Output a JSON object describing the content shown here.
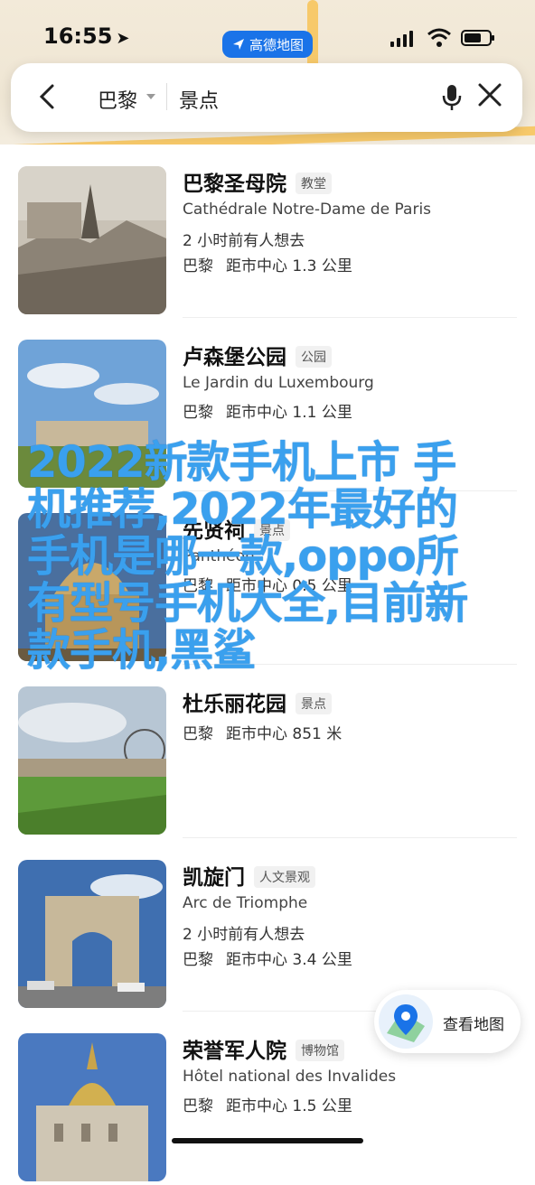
{
  "status_bar": {
    "time": "16:55",
    "location_arrow": "location-arrow-icon"
  },
  "app_pill": {
    "label": "高德地图"
  },
  "search": {
    "city": "巴黎",
    "query": "景点"
  },
  "places": [
    {
      "name": "巴黎圣母院",
      "tag": "教堂",
      "foreign": "Cathédrale Notre-Dame de Paris",
      "recent": "2 小时前有人想去",
      "city": "巴黎",
      "distance": "距市中心 1.3 公里"
    },
    {
      "name": "卢森堡公园",
      "tag": "公园",
      "foreign": "Le Jardin du Luxembourg",
      "recent": "",
      "city": "巴黎",
      "distance": "距市中心 1.1 公里"
    },
    {
      "name": "先贤祠",
      "tag": "景点",
      "foreign": "Panthéon",
      "recent": "",
      "city": "巴黎",
      "distance": "距市中心 0.5 公里"
    },
    {
      "name": "杜乐丽花园",
      "tag": "景点",
      "foreign": "",
      "recent": "",
      "city": "巴黎",
      "distance": "距市中心 851 米"
    },
    {
      "name": "凯旋门",
      "tag": "人文景观",
      "foreign": "Arc de Triomphe",
      "recent": "2 小时前有人想去",
      "city": "巴黎",
      "distance": "距市中心 3.4 公里"
    },
    {
      "name": "荣誉军人院",
      "tag": "博物馆",
      "foreign": "Hôtel national des Invalides",
      "recent": "",
      "city": "巴黎",
      "distance": "距市中心 1.5 公里"
    }
  ],
  "view_map_button": {
    "label": "查看地图"
  },
  "overlay_text": "2022新款手机上市 手机推荐,2022年最好的手机是哪一款,oppo所有型号手机大全,目前新款手机,黑鲨",
  "colors": {
    "accent": "#1a73e8",
    "overlay": "#3aa0ee"
  }
}
